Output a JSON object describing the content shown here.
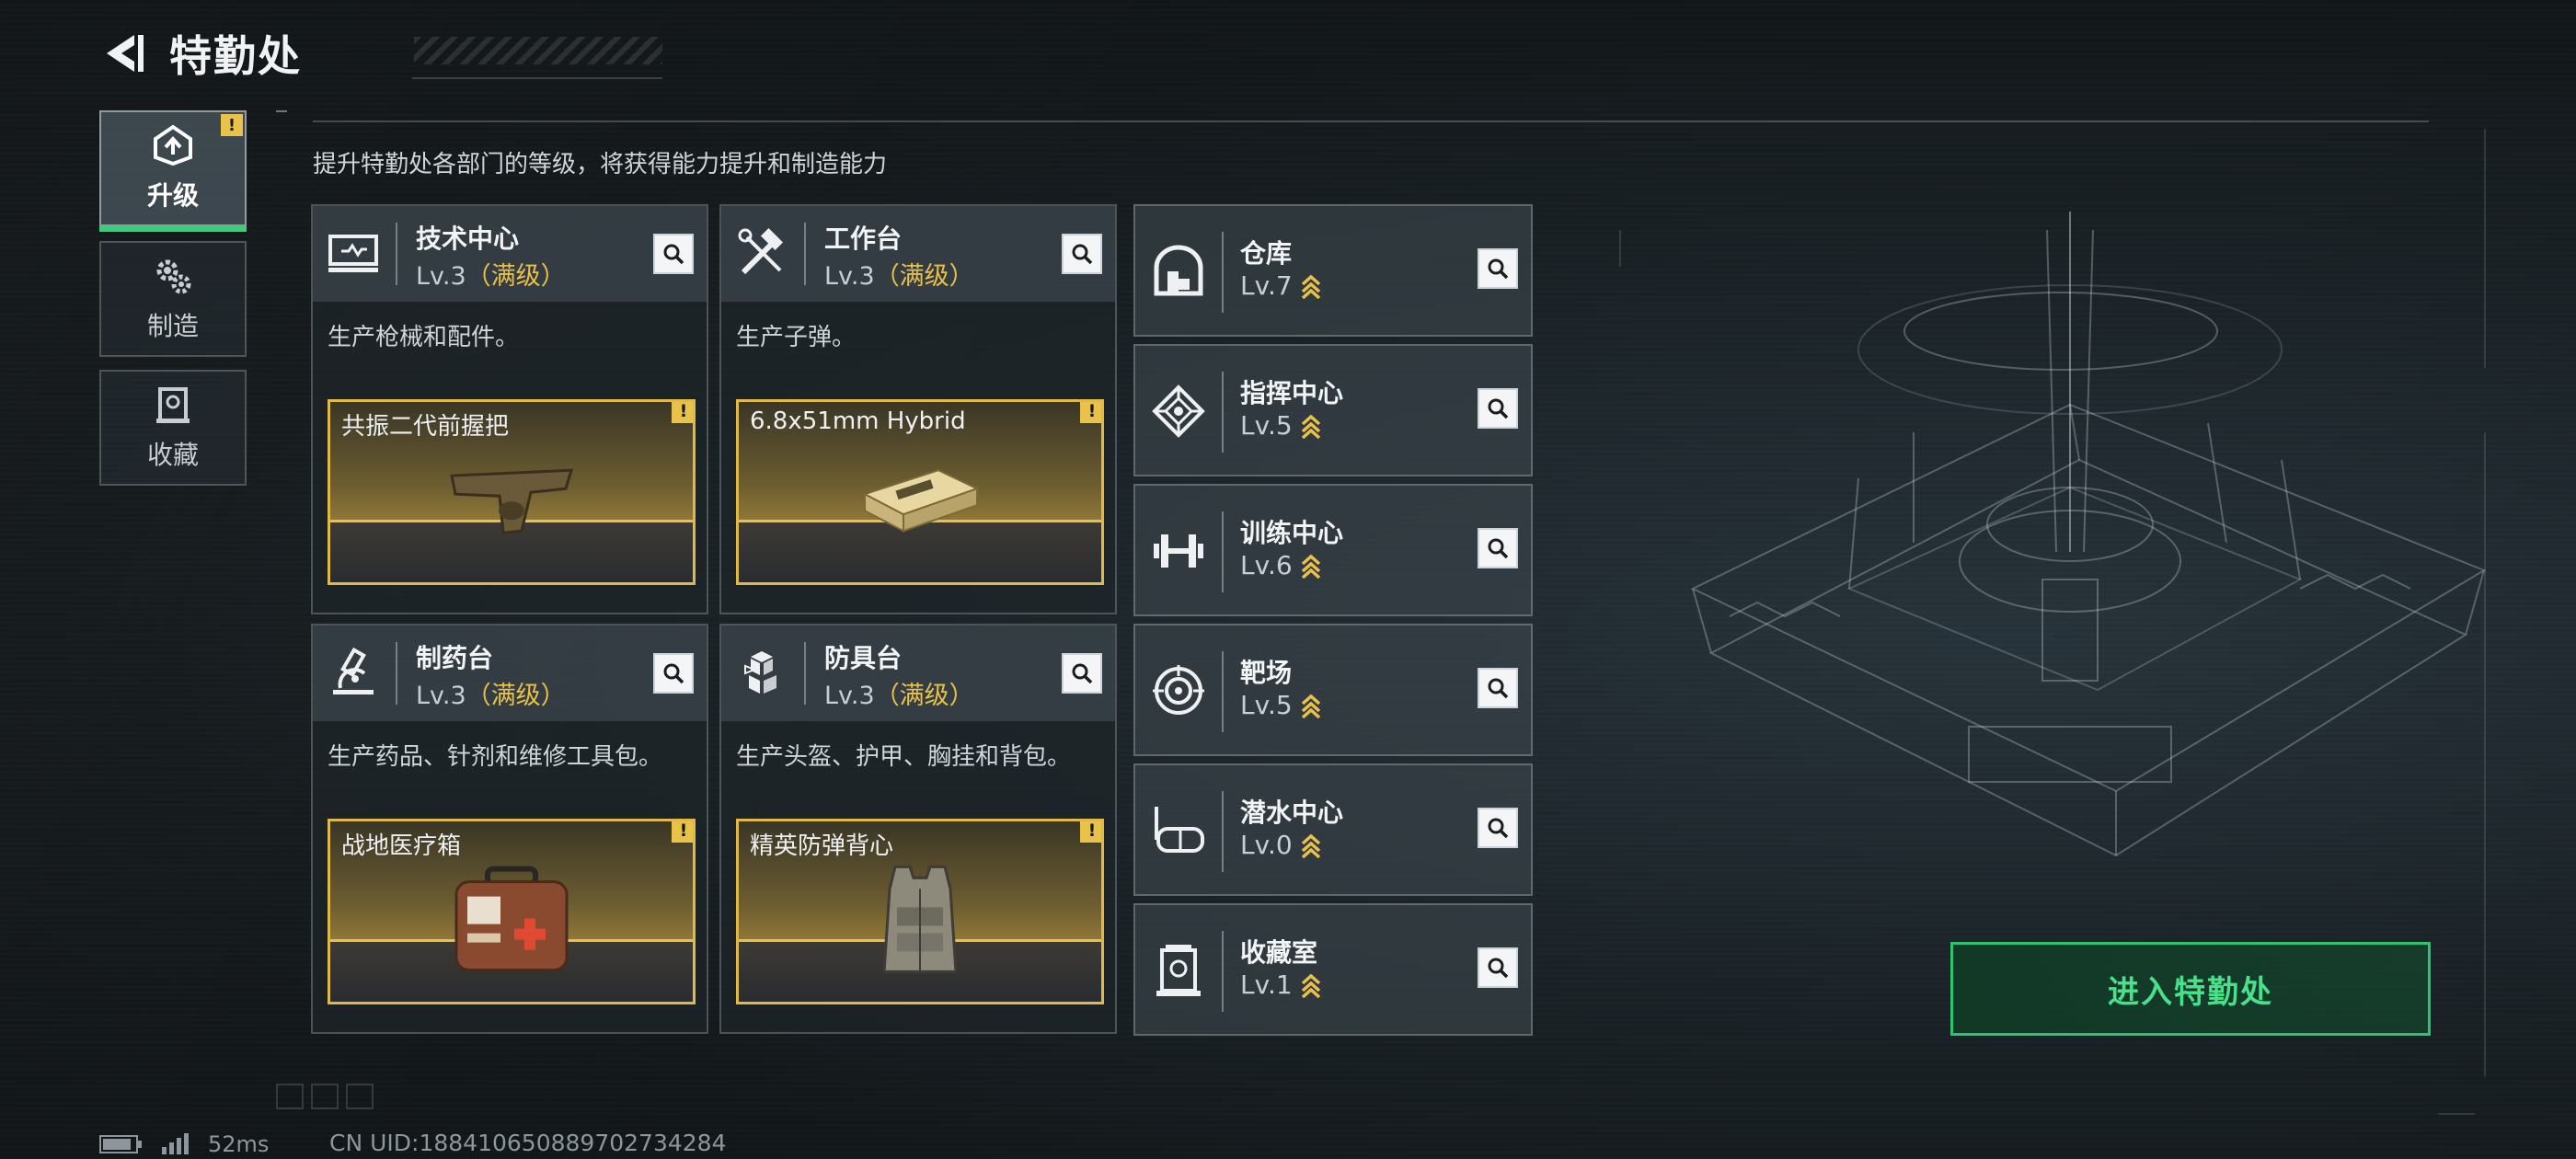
{
  "header": {
    "title": "特勤处",
    "back_icon": "back-arrow-icon"
  },
  "sidebar": {
    "tabs": [
      {
        "label": "升级",
        "icon": "upgrade-icon",
        "active": true,
        "alert": "!"
      },
      {
        "label": "制造",
        "icon": "gears-icon",
        "active": false
      },
      {
        "label": "收藏",
        "icon": "collection-icon",
        "active": false
      }
    ]
  },
  "subtitle": "提升特勤处各部门的等级，将获得能力提升和制造能力",
  "stations": [
    {
      "name": "技术中心",
      "level": "Lv.3",
      "max_tag": "（满级）",
      "desc": "生产枪械和配件。",
      "craft": "共振二代前握把",
      "craft_alert": "!",
      "icon": "tech-center-icon"
    },
    {
      "name": "工作台",
      "level": "Lv.3",
      "max_tag": "（满级）",
      "desc": "生产子弹。",
      "craft": "6.8x51mm Hybrid",
      "craft_alert": "!",
      "icon": "workbench-icon"
    },
    {
      "name": "制药台",
      "level": "Lv.3",
      "max_tag": "（满级）",
      "desc": "生产药品、针剂和维修工具包。",
      "craft": "战地医疗箱",
      "craft_alert": "!",
      "icon": "microscope-icon"
    },
    {
      "name": "防具台",
      "level": "Lv.3",
      "max_tag": "（满级）",
      "desc": "生产头盔、护甲、胸挂和背包。",
      "craft": "精英防弹背心",
      "craft_alert": "!",
      "icon": "armor-bench-icon"
    }
  ],
  "facilities": [
    {
      "name": "仓库",
      "level": "Lv.7",
      "icon": "warehouse-icon"
    },
    {
      "name": "指挥中心",
      "level": "Lv.5",
      "icon": "command-center-icon"
    },
    {
      "name": "训练中心",
      "level": "Lv.6",
      "icon": "dumbbell-icon"
    },
    {
      "name": "靶场",
      "level": "Lv.5",
      "icon": "target-icon"
    },
    {
      "name": "潜水中心",
      "level": "Lv.0",
      "icon": "diving-mask-icon"
    },
    {
      "name": "收藏室",
      "level": "Lv.1",
      "icon": "collection-room-icon"
    }
  ],
  "enter_button": "进入特勤处",
  "status": {
    "ping": "52ms",
    "uid": "CN UID:1884106508897027342​84"
  },
  "colors": {
    "accent_green": "#2ec36e",
    "gold": "#e8c04a",
    "alert": "#e9c24a"
  }
}
